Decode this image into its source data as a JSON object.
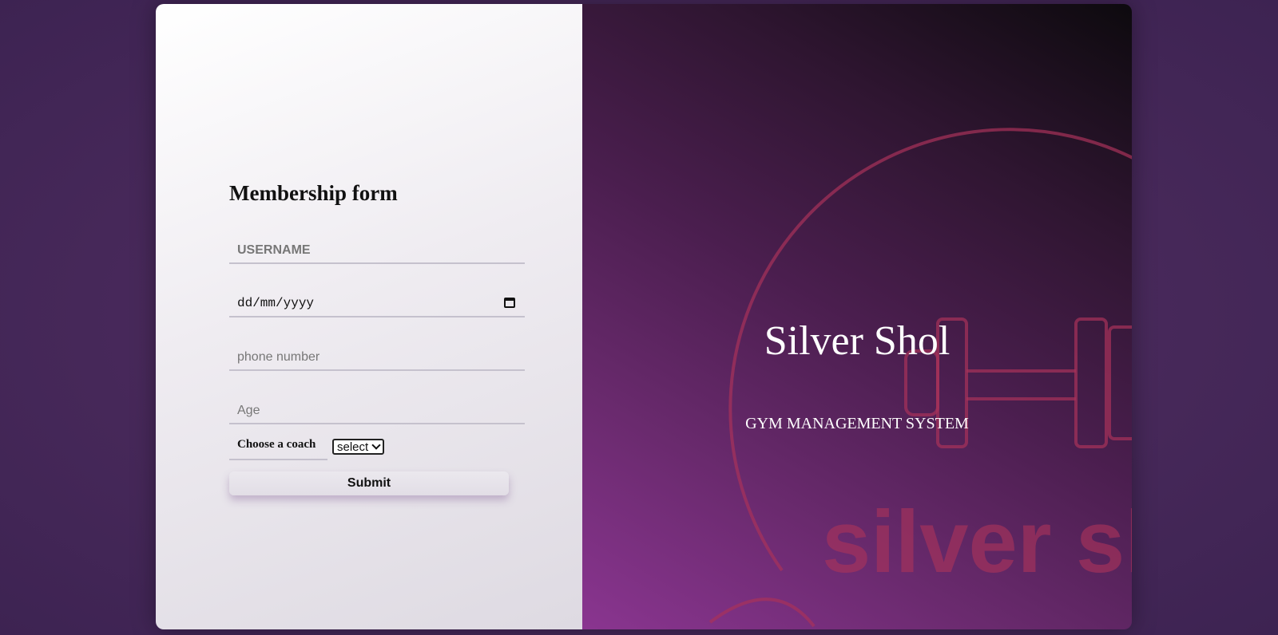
{
  "form": {
    "title": "Membership form",
    "username_placeholder": "USERNAME",
    "date_placeholder": "dd/mm/yyyy",
    "phone_placeholder": "phone number",
    "age_placeholder": "Age",
    "coach_label": "Choose a coach",
    "coach_select_value": "select",
    "submit_label": "Submit"
  },
  "brand": {
    "title": "Silver Shol",
    "subtitle": "GYM MANAGEMENT SYSTEM",
    "watermark_text": "silver sh",
    "watermark_icon": "dumbbell-icon"
  },
  "colors": {
    "accent": "#8a3590",
    "watermark": "#a8325a"
  }
}
